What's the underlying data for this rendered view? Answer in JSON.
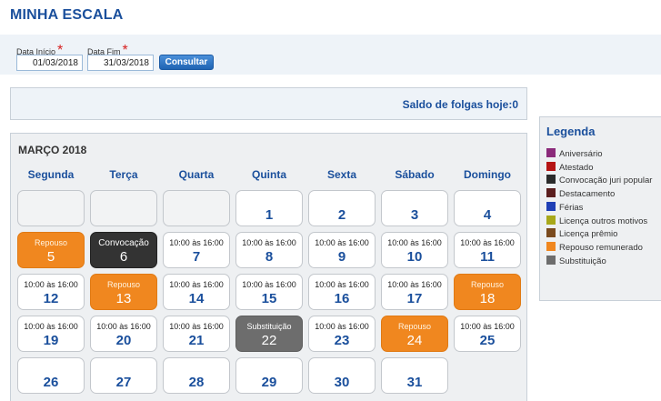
{
  "page_title": "MINHA ESCALA",
  "filters": {
    "start_label": "Data Início",
    "end_label": "Data Fim",
    "required_mark": "*",
    "start_value": "01/03/2018",
    "end_value": "31/03/2018",
    "submit_label": "Consultar"
  },
  "saldo_text": "Saldo de folgas hoje:0",
  "calendar": {
    "month_title": "MARÇO 2018",
    "weekdays": [
      "Segunda",
      "Terça",
      "Quarta",
      "Quinta",
      "Sexta",
      "Sábado",
      "Domingo"
    ],
    "days": [
      {
        "day": "",
        "label": "",
        "type": "empty"
      },
      {
        "day": "",
        "label": "",
        "type": "empty"
      },
      {
        "day": "",
        "label": "",
        "type": "empty"
      },
      {
        "day": "1",
        "label": "",
        "type": "plain"
      },
      {
        "day": "2",
        "label": "",
        "type": "plain"
      },
      {
        "day": "3",
        "label": "",
        "type": "plain"
      },
      {
        "day": "4",
        "label": "",
        "type": "plain"
      },
      {
        "day": "5",
        "label": "Repouso",
        "type": "orange"
      },
      {
        "day": "6",
        "label": "Convocação",
        "type": "dark"
      },
      {
        "day": "7",
        "label": "10:00 às 16:00",
        "type": "plain"
      },
      {
        "day": "8",
        "label": "10:00 às 16:00",
        "type": "plain"
      },
      {
        "day": "9",
        "label": "10:00 às 16:00",
        "type": "plain"
      },
      {
        "day": "10",
        "label": "10:00 às 16:00",
        "type": "plain"
      },
      {
        "day": "11",
        "label": "10:00 às 16:00",
        "type": "plain"
      },
      {
        "day": "12",
        "label": "10:00 às 16:00",
        "type": "plain"
      },
      {
        "day": "13",
        "label": "Repouso",
        "type": "orange"
      },
      {
        "day": "14",
        "label": "10:00 às 16:00",
        "type": "plain"
      },
      {
        "day": "15",
        "label": "10:00 às 16:00",
        "type": "plain"
      },
      {
        "day": "16",
        "label": "10:00 às 16:00",
        "type": "plain"
      },
      {
        "day": "17",
        "label": "10:00 às 16:00",
        "type": "plain"
      },
      {
        "day": "18",
        "label": "Repouso",
        "type": "orange"
      },
      {
        "day": "19",
        "label": "10:00 às 16:00",
        "type": "plain"
      },
      {
        "day": "20",
        "label": "10:00 às 16:00",
        "type": "plain"
      },
      {
        "day": "21",
        "label": "10:00 às 16:00",
        "type": "plain"
      },
      {
        "day": "22",
        "label": "Substituição",
        "type": "gray"
      },
      {
        "day": "23",
        "label": "10:00 às 16:00",
        "type": "plain"
      },
      {
        "day": "24",
        "label": "Repouso",
        "type": "orange"
      },
      {
        "day": "25",
        "label": "10:00 às 16:00",
        "type": "plain"
      },
      {
        "day": "26",
        "label": "",
        "type": "plain"
      },
      {
        "day": "27",
        "label": "",
        "type": "plain"
      },
      {
        "day": "28",
        "label": "",
        "type": "plain"
      },
      {
        "day": "29",
        "label": "",
        "type": "plain"
      },
      {
        "day": "30",
        "label": "",
        "type": "plain"
      },
      {
        "day": "31",
        "label": "",
        "type": "plain"
      }
    ]
  },
  "legend": {
    "title": "Legenda",
    "items": [
      {
        "label": "Aniversário",
        "color": "#8b2a7a"
      },
      {
        "label": "Atestado",
        "color": "#b51414"
      },
      {
        "label": "Convocação juri popular",
        "color": "#2b2b2b"
      },
      {
        "label": "Destacamento",
        "color": "#5a1e1e"
      },
      {
        "label": "Férias",
        "color": "#1f3fb5"
      },
      {
        "label": "Licença outros motivos",
        "color": "#a8a81a"
      },
      {
        "label": "Licença prêmio",
        "color": "#7a4a1e"
      },
      {
        "label": "Repouso remunerado",
        "color": "#f0871f"
      },
      {
        "label": "Substituição",
        "color": "#6d6d6d"
      }
    ]
  }
}
